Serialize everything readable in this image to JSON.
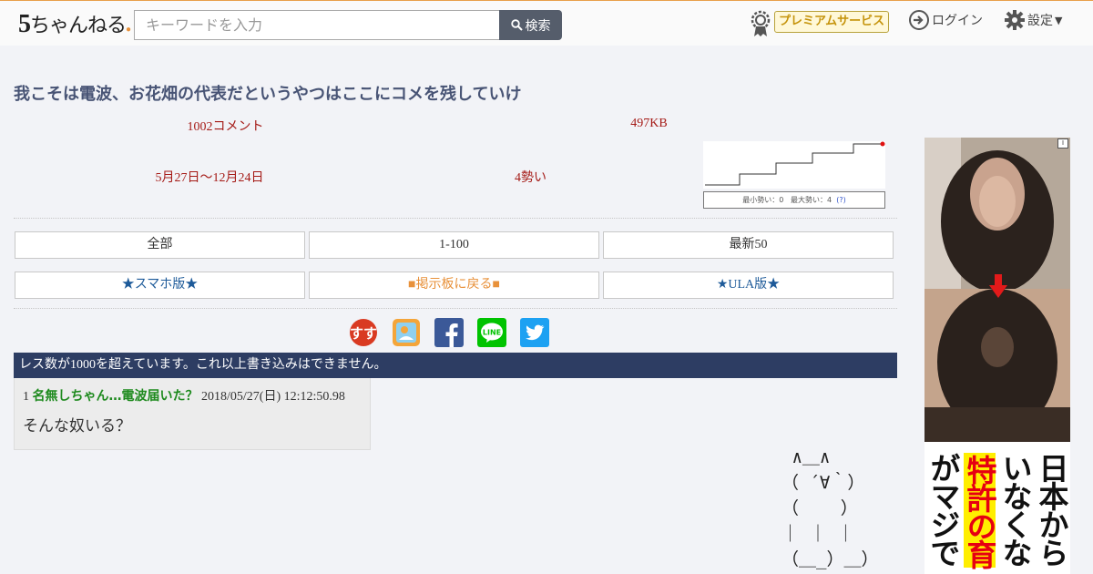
{
  "header": {
    "logo_number": "5",
    "logo_text": "ちゃんねる",
    "search": {
      "placeholder": "キーワードを入力",
      "button_label": "検索"
    },
    "premium_label": "プレミアムサービス",
    "login_label": "ログイン",
    "settings_label": "設定"
  },
  "thread": {
    "title": "我こそは電波、お花畑の代表だというやつはここにコメを残していけ",
    "comments": "1002コメント",
    "size": "497KB",
    "date_range": "5月27日〜12月24日",
    "momentum": "4勢い",
    "graph_caption": {
      "min": "最小勢い：0",
      "max": "最大勢い：4",
      "help": "(?)"
    }
  },
  "nav": {
    "all": "全部",
    "range": "1-100",
    "latest": "最新50",
    "smartphone": "★スマホ版★",
    "back_to_board": "■掲示板に戻る■",
    "ula": "★ULA版★"
  },
  "share_icons": [
    "sutamato-icon",
    "matome-icon",
    "facebook-icon",
    "line-icon",
    "twitter-icon"
  ],
  "notice": "レス数が1000を超えています。これ以上書き込みはできません。",
  "posts": [
    {
      "number": "1",
      "name": "名無しちゃん…電波届いた？",
      "date": "2018/05/27(日) 12:12:50.98",
      "body": "そんな奴いる？"
    }
  ],
  "ascii_art": " ∧＿∧\n（ ´∀｀）\n（    ）\n｜ ｜ ｜\n（＿_）＿）",
  "ad": {
    "info_label": "i",
    "columns": [
      "日本から",
      "いなくな",
      "特許の育",
      "がマジで"
    ]
  },
  "colors": {
    "accent_orange": "#e8913a",
    "title_blue": "#485475",
    "meta_red": "#a51b17",
    "notice_bg": "#2d3d63",
    "post_name_green": "#1e8a1e"
  }
}
